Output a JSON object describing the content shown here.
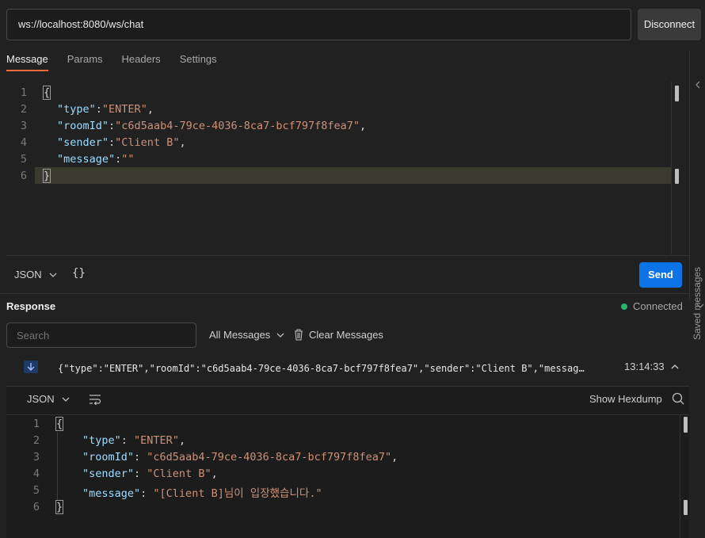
{
  "connection": {
    "url": "ws://localhost:8080/ws/chat",
    "disconnect_label": "Disconnect"
  },
  "tabs": [
    {
      "label": "Message",
      "active": true
    },
    {
      "label": "Params",
      "active": false
    },
    {
      "label": "Headers",
      "active": false
    },
    {
      "label": "Settings",
      "active": false
    }
  ],
  "saved_messages_label": "Saved messages",
  "editor": {
    "line_numbers": [
      "1",
      "2",
      "3",
      "4",
      "5",
      "6"
    ],
    "open_brace": "{",
    "close_brace": "}",
    "fields": [
      {
        "key": "\"type\"",
        "sep": ":",
        "value": "\"ENTER\"",
        "trail": ","
      },
      {
        "key": "\"roomId\"",
        "sep": ":",
        "value": "\"c6d5aab4-79ce-4036-8ca7-bcf797f8fea7\"",
        "trail": ","
      },
      {
        "key": "\"sender\"",
        "sep": ":",
        "value": "\"Client B\"",
        "trail": ","
      },
      {
        "key": "\"message\"",
        "sep": ":",
        "value": "\"\"",
        "trail": ""
      }
    ]
  },
  "composer": {
    "format_label": "JSON",
    "beautify_symbol": "{}",
    "send_label": "Send"
  },
  "response": {
    "title": "Response",
    "status": "Connected",
    "search_placeholder": "Search",
    "filter_label": "All Messages",
    "clear_label": "Clear Messages",
    "message_preview": "{\"type\":\"ENTER\",\"roomId\":\"c6d5aab4-79ce-4036-8ca7-bcf797f8fea7\",\"sender\":\"Client B\",\"message\":\"[Client B]님이 입장했습니다.\"}",
    "message_time": "13:14:33",
    "viewer_format": "JSON",
    "hexdump_label": "Show Hexdump",
    "body": {
      "line_numbers": [
        "1",
        "2",
        "3",
        "4",
        "5",
        "6"
      ],
      "open_brace": "{",
      "close_brace": "}",
      "fields": [
        {
          "key": "\"type\"",
          "sep": ": ",
          "value": "\"ENTER\"",
          "trail": ","
        },
        {
          "key": "\"roomId\"",
          "sep": ": ",
          "value": "\"c6d5aab4-79ce-4036-8ca7-bcf797f8fea7\"",
          "trail": ","
        },
        {
          "key": "\"sender\"",
          "sep": ": ",
          "value": "\"Client B\"",
          "trail": ","
        },
        {
          "key": "\"message\"",
          "sep": ": ",
          "value": "\"[Client B]님이 입장했습니다.\"",
          "trail": ""
        }
      ]
    }
  },
  "colors": {
    "accent_tab": "#ff6c37",
    "send_button": "#0d74e7",
    "connected_dot": "#29b36b",
    "json_key": "#9cdcfe",
    "json_string": "#ce9178"
  }
}
